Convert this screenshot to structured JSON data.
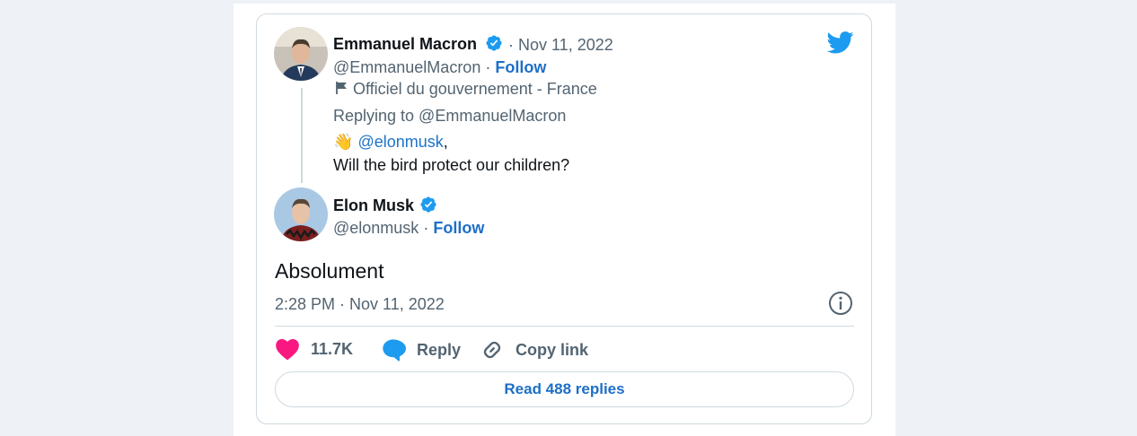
{
  "parent_tweet": {
    "author_name": "Emmanuel Macron",
    "date": "· Nov 11, 2022",
    "handle": "@EmmanuelMacron",
    "separator": "·",
    "follow_label": "Follow",
    "affiliation": "Officiel du gouvernement - France",
    "replying_to_label": "Replying to @EmmanuelMacron",
    "emoji": "👋",
    "mention": "@elonmusk",
    "mention_suffix": ",",
    "body": "Will the bird protect our children?"
  },
  "reply_tweet": {
    "author_name": "Elon Musk",
    "handle": "@elonmusk",
    "separator": "·",
    "follow_label": "Follow",
    "body": "Absolument",
    "timestamp": "2:28 PM · Nov 11, 2022"
  },
  "actions": {
    "like_count": "11.7K",
    "reply_label": "Reply",
    "copy_link_label": "Copy link"
  },
  "read_replies_label": "Read 488 replies",
  "colors": {
    "like": "#f91880",
    "reply_bubble": "#1d9bf0",
    "verified": "#1d9bf0",
    "twitter_brand": "#1d9bf0",
    "link": "#1d6fc7"
  }
}
